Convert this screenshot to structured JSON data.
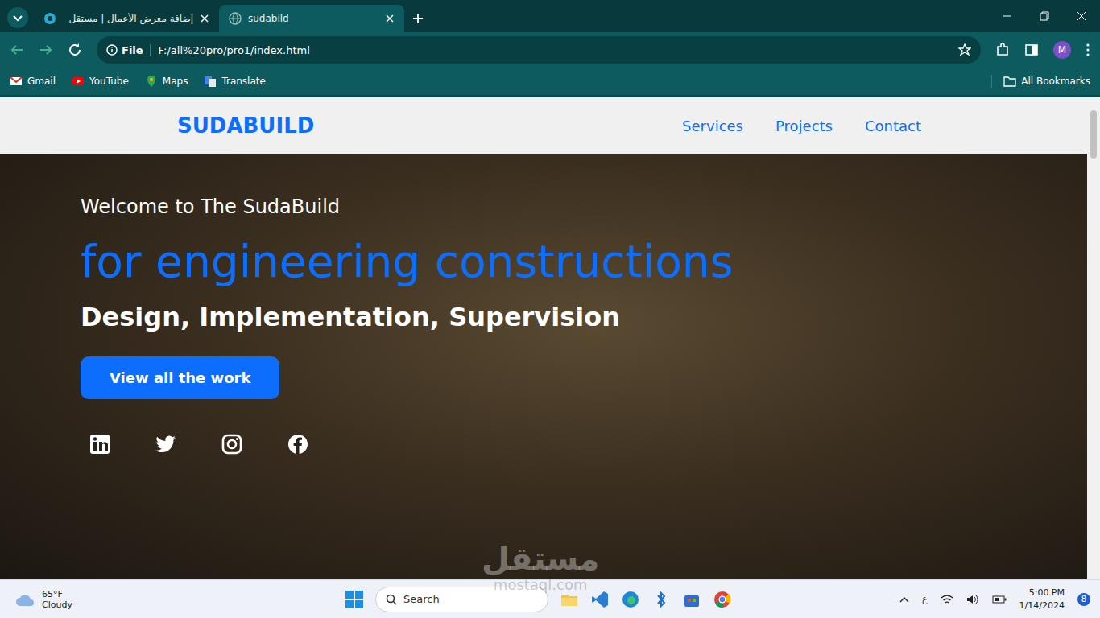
{
  "browser": {
    "tabs": [
      {
        "label": "إضافة معرض الأعمال | مستقل",
        "selected": false
      },
      {
        "label": "sudabild",
        "selected": true
      }
    ],
    "address": {
      "scheme": "File",
      "url": "F:/all%20pro/pro1/index.html"
    },
    "bookmarks": [
      "Gmail",
      "YouTube",
      "Maps",
      "Translate"
    ],
    "all_bookmarks": "All Bookmarks",
    "profile": "M"
  },
  "page": {
    "brand": "SUDABUILD",
    "nav": [
      "Services",
      "Projects",
      "Contact"
    ],
    "hero": {
      "welcome": "Welcome to The SudaBuild",
      "headline": "for engineering constructions",
      "tagline": "Design, Implementation, Supervision",
      "button": "View all the work"
    }
  },
  "watermark": {
    "arabic": "مستقل",
    "latin": "mostaql.com"
  },
  "taskbar": {
    "weather": {
      "temp": "65°F",
      "condition": "Cloudy"
    },
    "search": {
      "placeholder": "Search"
    },
    "language": "ع",
    "time": "5:00 PM",
    "date": "1/14/2024",
    "notifications": "8"
  }
}
